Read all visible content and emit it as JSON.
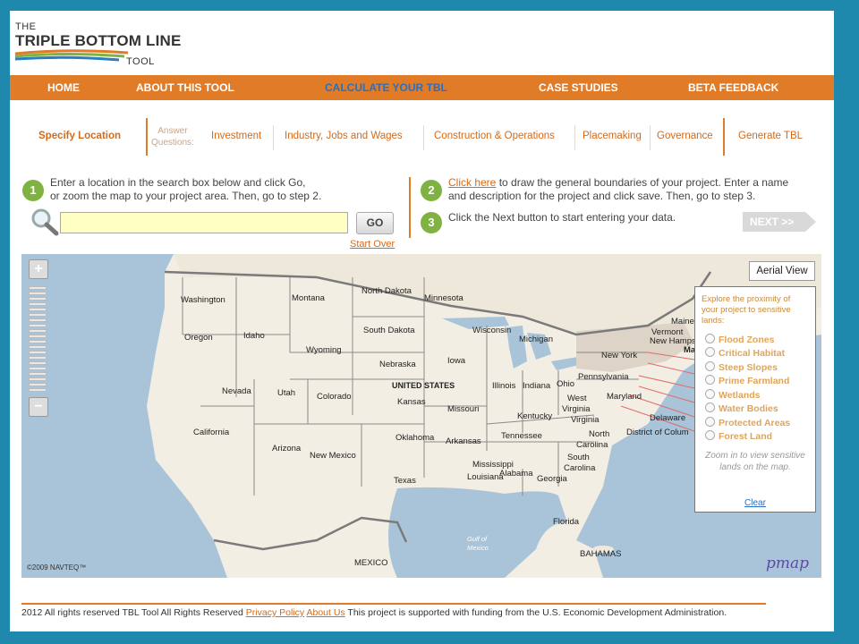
{
  "logo": {
    "line1": "THE",
    "line2": "TRIPLE BOTTOM LINE",
    "line3": "TOOL"
  },
  "nav": [
    {
      "label": "HOME"
    },
    {
      "label": "ABOUT THIS TOOL"
    },
    {
      "label": "CALCULATE YOUR TBL",
      "active": true
    },
    {
      "label": "CASE STUDIES"
    },
    {
      "label": "BETA FEEDBACK"
    }
  ],
  "steps": {
    "current": "Specify Location",
    "answer_label_1": "Answer",
    "answer_label_2": "Questions:",
    "items": [
      "Investment",
      "Industry, Jobs and Wages",
      "Construction & Operations",
      "Placemaking",
      "Governance"
    ],
    "generate": "Generate TBL"
  },
  "instructions": {
    "step1_num": "1",
    "step1_line1": "Enter a location in the search box below and click Go,",
    "step1_line2": "or zoom the map to your project area. Then, go to step 2.",
    "step2_num": "2",
    "step2_link": "Click here",
    "step2_line1": " to draw the general boundaries of your project. Enter a name",
    "step2_line2": "and description for the project and click save. Then, go to step 3.",
    "step3_num": "3",
    "step3_text": "Click the Next button to start entering your data."
  },
  "search": {
    "value": "",
    "go_label": "GO",
    "start_over": "Start Over"
  },
  "next_label": "NEXT >>",
  "map": {
    "aerial_view": "Aerial View",
    "copyright": "©2009 NAVTEQ™",
    "brand": "pmap",
    "labels": {
      "washington": "Washington",
      "montana": "Montana",
      "north_dakota": "North Dakota",
      "minnesota": "Minnesota",
      "oregon": "Oregon",
      "idaho": "Idaho",
      "south_dakota": "South Dakota",
      "wisconsin": "Wisconsin",
      "michigan": "Michigan",
      "wyoming": "Wyoming",
      "nebraska": "Nebraska",
      "iowa": "Iowa",
      "new_york": "New York",
      "pennsylvania": "Pennsylvania",
      "nevada": "Nevada",
      "utah": "Utah",
      "colorado": "Colorado",
      "united_states": "UNITED STATES",
      "illinois": "Illinois",
      "indiana": "Indiana",
      "ohio": "Ohio",
      "kansas": "Kansas",
      "missouri": "Missouri",
      "west_virginia": "West",
      "west_virginia2": "Virginia",
      "maryland": "Maryland",
      "california": "California",
      "kentucky": "Kentucky",
      "virginia": "Virginia",
      "delaware": "Delaware",
      "oklahoma": "Oklahoma",
      "arkansas": "Arkansas",
      "tennessee": "Tennessee",
      "dc": "District of Colum",
      "north_carolina": "North",
      "north_carolina2": "Carolina",
      "arizona": "Arizona",
      "new_mexico": "New Mexico",
      "south_carolina": "South",
      "south_carolina2": "Carolina",
      "mississippi": "Mississippi",
      "alabama": "Alabama",
      "georgia": "Georgia",
      "texas": "Texas",
      "louisiana": "Louisiana",
      "florida": "Florida",
      "gulf": "Gulf of",
      "gulf2": "Mexico",
      "mexico": "MEXICO",
      "bahamas": "BAHAMAS",
      "vermont": "Vermont",
      "new_hamps": "New Hamps",
      "maine": "Maine",
      "ma": "Ma"
    }
  },
  "panel": {
    "intro": "Explore the proximity of your project to sensitive lands:",
    "layers": [
      "Flood Zones",
      "Critical Habitat",
      "Steep Slopes",
      "Prime Farmland",
      "Wetlands",
      "Water Bodies",
      "Protected Areas",
      "Forest Land"
    ],
    "zoom_note": "Zoom in to view sensitive lands on the map.",
    "clear": "Clear"
  },
  "footer": {
    "text1": "2012 All rights reserved TBL Tool All Rights Reserved ",
    "privacy": "Privacy Policy",
    "about": "About Us",
    "text2": " This project is supported with funding from the U.S. Economic Development Administration."
  }
}
